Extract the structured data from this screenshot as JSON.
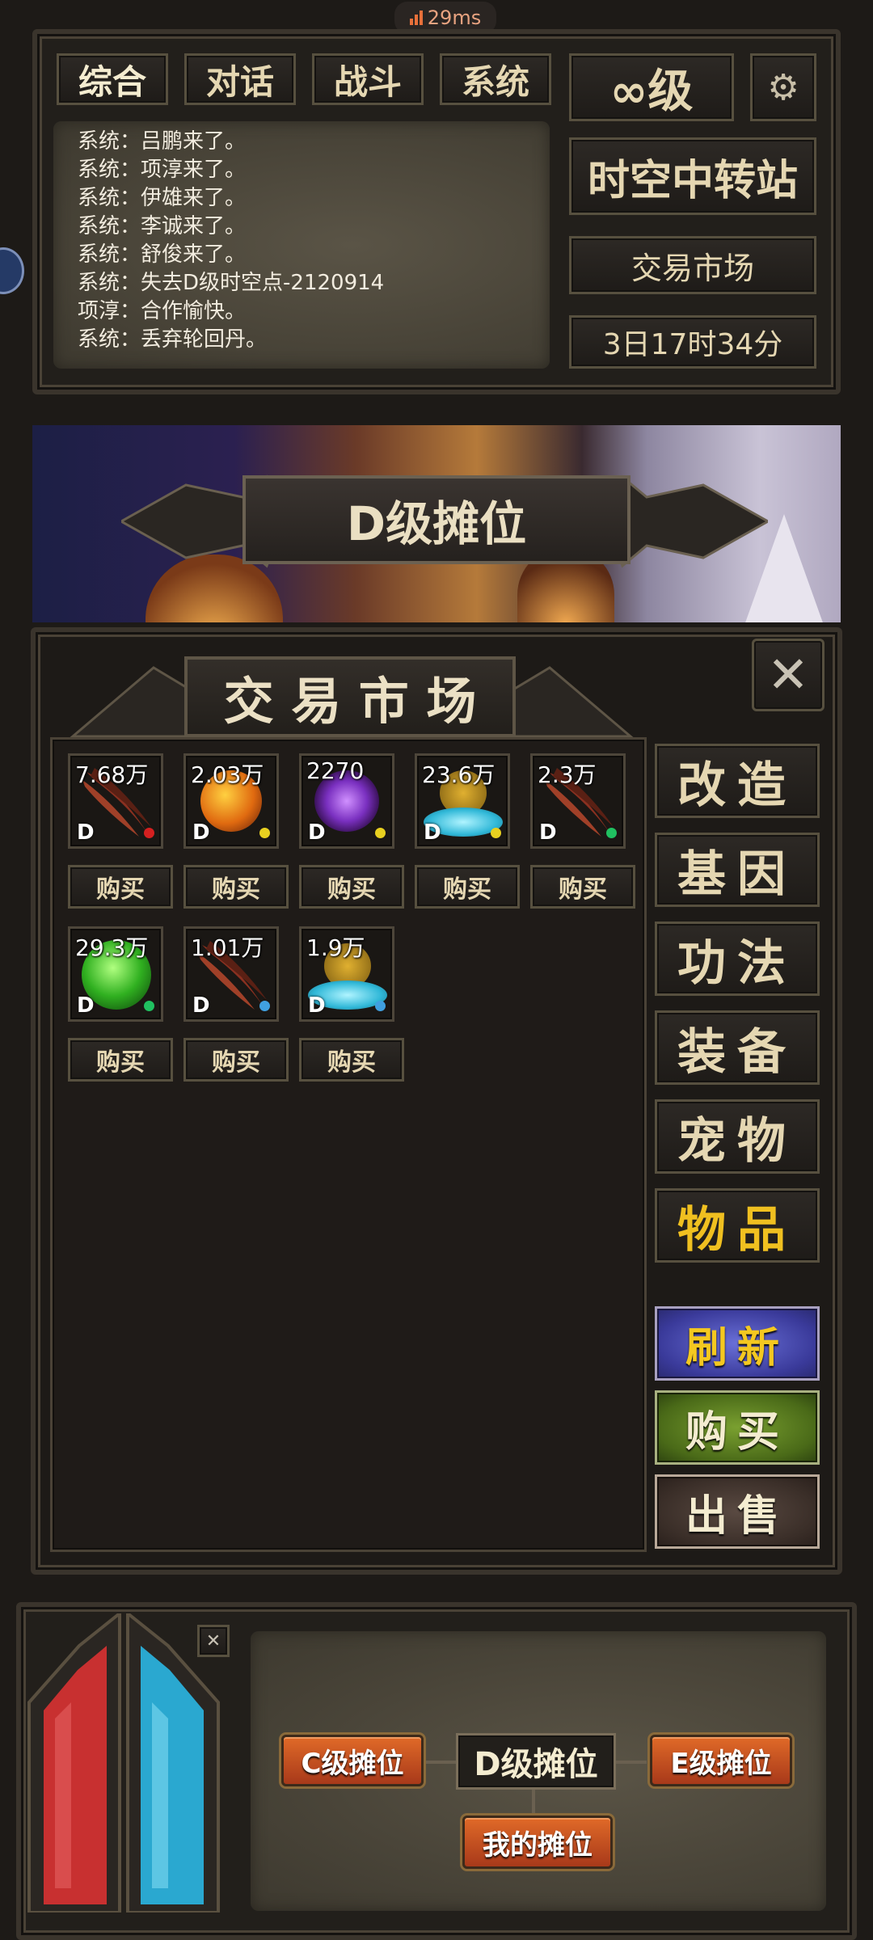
{
  "status_bar": {
    "ping": "29ms"
  },
  "chat": {
    "tabs": [
      "综合",
      "对话",
      "战斗",
      "系统"
    ],
    "lines": [
      "系统：吕鹏来了。",
      "系统：项淳来了。",
      "系统：伊雄来了。",
      "系统：李诚来了。",
      "系统：舒俊来了。",
      "系统：失去D级时空点-2120914",
      "项淳：合作愉快。",
      "系统：丢弃轮回丹。"
    ]
  },
  "player": {
    "level": "∞级",
    "location": "时空中转站",
    "area": "交易市场",
    "timer": "3日17时34分"
  },
  "banner": {
    "title": "D级摊位"
  },
  "market": {
    "title": "交 易 市 场",
    "buy_label": "购买",
    "items": [
      {
        "price": "7.68万",
        "grade": "D",
        "icon": "red-claw-icon",
        "dot_color": "#d42020"
      },
      {
        "price": "2.03万",
        "grade": "D",
        "icon": "fire-orb-icon",
        "dot_color": "#e8d020"
      },
      {
        "price": "2270",
        "grade": "D",
        "icon": "purple-vortex-icon",
        "dot_color": "#e8d020"
      },
      {
        "price": "23.6万",
        "grade": "D",
        "icon": "golden-pool-icon",
        "dot_color": "#e8d020"
      },
      {
        "price": "2.3万",
        "grade": "D",
        "icon": "red-claw-icon",
        "dot_color": "#20c060"
      },
      {
        "price": "29.3万",
        "grade": "D",
        "icon": "green-orb-icon",
        "dot_color": "#20c060"
      },
      {
        "price": "1.01万",
        "grade": "D",
        "icon": "red-claw-icon",
        "dot_color": "#40a0e0"
      },
      {
        "price": "1.9万",
        "grade": "D",
        "icon": "golden-pool-icon",
        "dot_color": "#40a0e0"
      }
    ],
    "categories": [
      "改造",
      "基因",
      "功法",
      "装备",
      "宠物",
      "物品"
    ],
    "active_category": "物品",
    "actions": {
      "refresh": "刷新",
      "buy": "购买",
      "sell": "出售"
    }
  },
  "stalls": {
    "c": "C级摊位",
    "d": "D级摊位",
    "e": "E级摊位",
    "mine": "我的摊位"
  },
  "colors": {
    "active_gold": "#f0c020",
    "text_cream": "#e8dcc0",
    "hp_red": "#c83030",
    "mp_blue": "#2aa8d0"
  }
}
